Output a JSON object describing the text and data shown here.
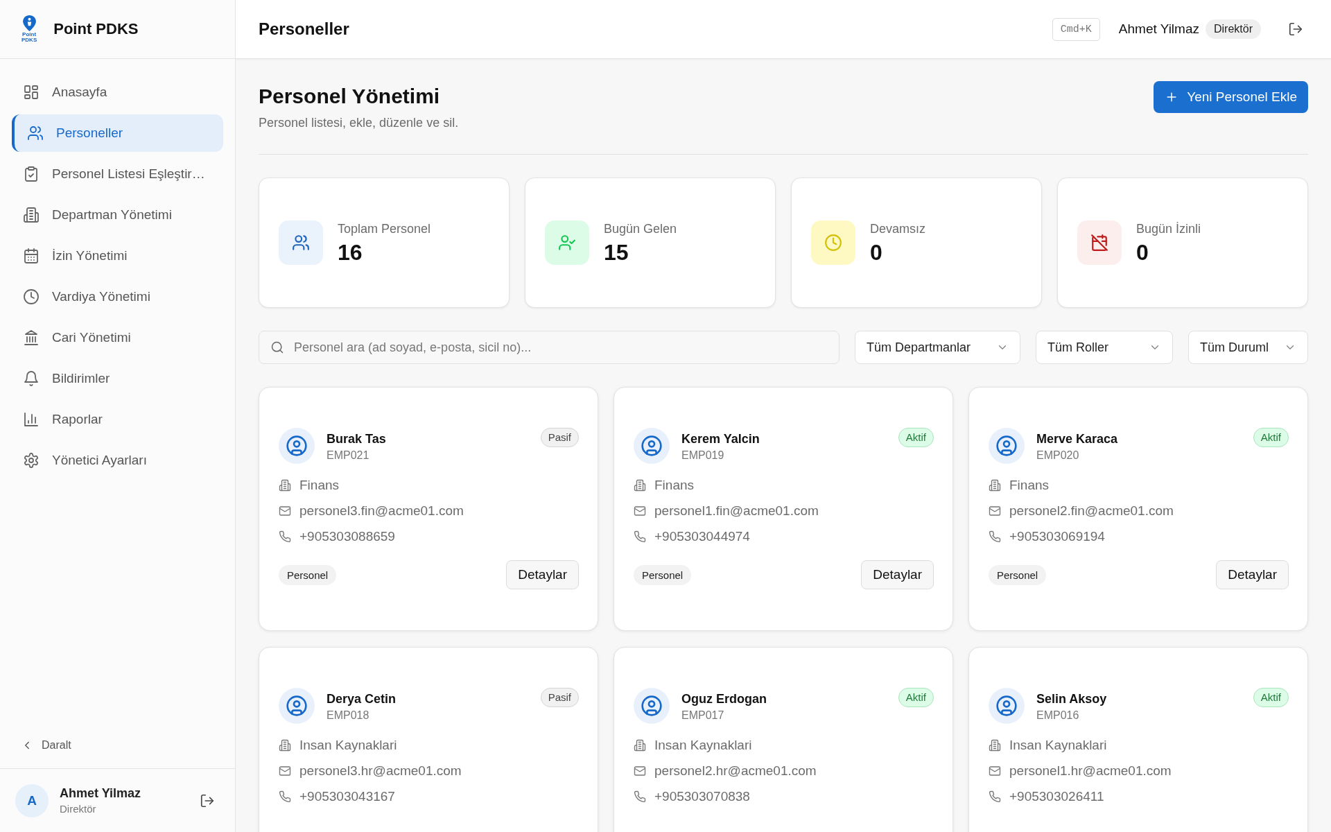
{
  "sidebar": {
    "logo_caption": [
      "Point",
      "PDKS"
    ],
    "brand": "Point PDKS",
    "nav": [
      {
        "label": "Anasayfa",
        "selected": false
      },
      {
        "label": "Personeller",
        "selected": true
      },
      {
        "label": "Personel Listesi Eşleştir…",
        "selected": false
      },
      {
        "label": "Departman Yönetimi",
        "selected": false
      },
      {
        "label": "İzin Yönetimi",
        "selected": false
      },
      {
        "label": "Vardiya Yönetimi",
        "selected": false
      },
      {
        "label": "Cari Yönetimi",
        "selected": false
      },
      {
        "label": "Bildirimler",
        "selected": false
      },
      {
        "label": "Raporlar",
        "selected": false
      },
      {
        "label": "Yönetici Ayarları",
        "selected": false
      }
    ],
    "collapse": "Daralt",
    "user": {
      "initial": "A",
      "name": "Ahmet Yilmaz",
      "role": "Direktör"
    }
  },
  "header": {
    "title": "Personeller",
    "shortcut": "Cmd+K",
    "user_name": "Ahmet Yilmaz",
    "user_role": "Direktör"
  },
  "page": {
    "title": "Personel Yönetimi",
    "subtitle": "Personel listesi, ekle, düzenle ve sil.",
    "add_button": "Yeni Personel Ekle"
  },
  "stats": [
    {
      "label": "Toplam Personel",
      "value": "16",
      "color": "#eaf2fc"
    },
    {
      "label": "Bugün Gelen",
      "value": "15",
      "color": "#dcfce7"
    },
    {
      "label": "Devamsız",
      "value": "0",
      "color": "#fef9c3"
    },
    {
      "label": "Bugün İzinli",
      "value": "0",
      "color": "#fdeeee"
    }
  ],
  "filters": {
    "search_placeholder": "Personel ara (ad soyad, e-posta, sicil no)...",
    "dropdowns": [
      {
        "value": "Tüm Departmanlar"
      },
      {
        "value": "Tüm Roller"
      },
      {
        "value": "Tüm Duruml"
      }
    ]
  },
  "employees": [
    {
      "name": "Burak Tas",
      "id": "EMP021",
      "status": "Pasif",
      "active": false,
      "department": "Finans",
      "email": "personel3.fin@acme01.com",
      "phone": "+905303088659",
      "role": "Personel",
      "action": "Detaylar"
    },
    {
      "name": "Kerem Yalcin",
      "id": "EMP019",
      "status": "Aktif",
      "active": true,
      "department": "Finans",
      "email": "personel1.fin@acme01.com",
      "phone": "+905303044974",
      "role": "Personel",
      "action": "Detaylar"
    },
    {
      "name": "Merve Karaca",
      "id": "EMP020",
      "status": "Aktif",
      "active": true,
      "department": "Finans",
      "email": "personel2.fin@acme01.com",
      "phone": "+905303069194",
      "role": "Personel",
      "action": "Detaylar"
    },
    {
      "name": "Derya Cetin",
      "id": "EMP018",
      "status": "Pasif",
      "active": false,
      "department": "Insan Kaynaklari",
      "email": "personel3.hr@acme01.com",
      "phone": "+905303043167"
    },
    {
      "name": "Oguz Erdogan",
      "id": "EMP017",
      "status": "Aktif",
      "active": true,
      "department": "Insan Kaynaklari",
      "email": "personel2.hr@acme01.com",
      "phone": "+905303070838"
    },
    {
      "name": "Selin Aksoy",
      "id": "EMP016",
      "status": "Aktif",
      "active": true,
      "department": "Insan Kaynaklari",
      "email": "personel1.hr@acme01.com",
      "phone": "+905303026411"
    }
  ]
}
